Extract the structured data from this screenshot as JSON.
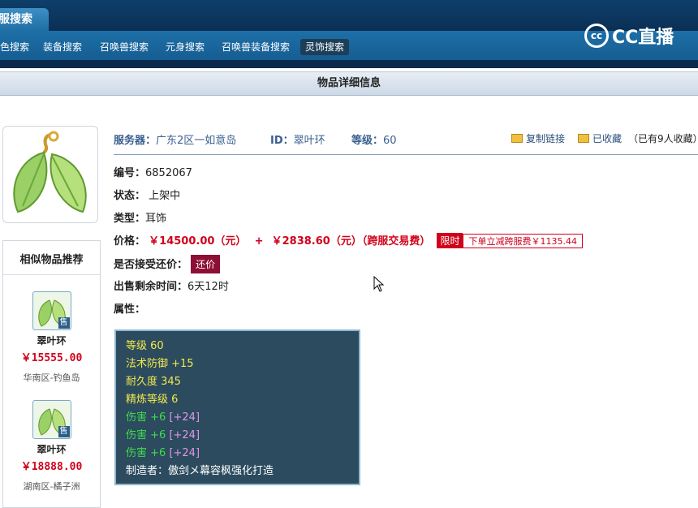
{
  "top_tab": {
    "label": "服搜索"
  },
  "nav": [
    {
      "label": "色搜索"
    },
    {
      "label": "装备搜索"
    },
    {
      "label": "召唤兽搜索"
    },
    {
      "label": "元身搜索"
    },
    {
      "label": "召唤兽装备搜索"
    },
    {
      "label": "灵饰搜索"
    }
  ],
  "logo": {
    "text": "CC直播",
    "mark": "cc"
  },
  "page_title": "物品详细信息",
  "header": {
    "server_label": "服务器：",
    "server_value": "广东2区一如意岛",
    "id_label": "ID：",
    "id_value": "翠叶环",
    "level_label": "等级：",
    "level_value": "60",
    "copy_link": "复制链接",
    "favorited": "已收藏",
    "fav_count": "（已有9人收藏）"
  },
  "fields": {
    "number_label": "编号：",
    "number_value": "6852067",
    "status_label": "状态：",
    "status_value": "上架中",
    "type_label": "类型：",
    "type_value": "耳饰",
    "price_label": "价格：",
    "price_value": "￥14500.00（元）",
    "price_plus": "+",
    "fee_value": "￥2838.60（元）（跨服交易费）",
    "limit_tag": "限时",
    "limit_text": "下单立减跨服费￥1135.44",
    "bargain_label": "是否接受还价：",
    "bargain_button": "还价",
    "remaining_label": "出售剩余时间：",
    "remaining_value": "6天12时",
    "attr_label": "属性："
  },
  "attributes": [
    {
      "text": "等级 60",
      "color": "yellow"
    },
    {
      "text": "法术防御 +15",
      "color": "yellow"
    },
    {
      "text": "耐久度 345",
      "color": "yellow"
    },
    {
      "text": "精炼等级 6",
      "color": "yellow"
    },
    {
      "text": "伤害 +6",
      "extra": "[+24]",
      "color": "green"
    },
    {
      "text": "伤害 +6",
      "extra": "[+24]",
      "color": "green"
    },
    {
      "text": "伤害 +6",
      "extra": "[+24]",
      "color": "green"
    },
    {
      "text": "制造者：傲剑メ幕容枫强化打造",
      "color": "white"
    }
  ],
  "sidebar": {
    "title": "相似物品推荐",
    "sell_badge": "售",
    "items": [
      {
        "name": "翠叶环",
        "price": "￥15555.00",
        "location": "华南区-钓鱼岛"
      },
      {
        "name": "翠叶环",
        "price": "￥18888.00",
        "location": "湖南区-橘子洲"
      }
    ]
  },
  "colors": {
    "topbar": "#0b2f55",
    "subbar": "#1e6fa8",
    "price_red": "#d0021b",
    "attr_bg": "#2c4b5e"
  }
}
